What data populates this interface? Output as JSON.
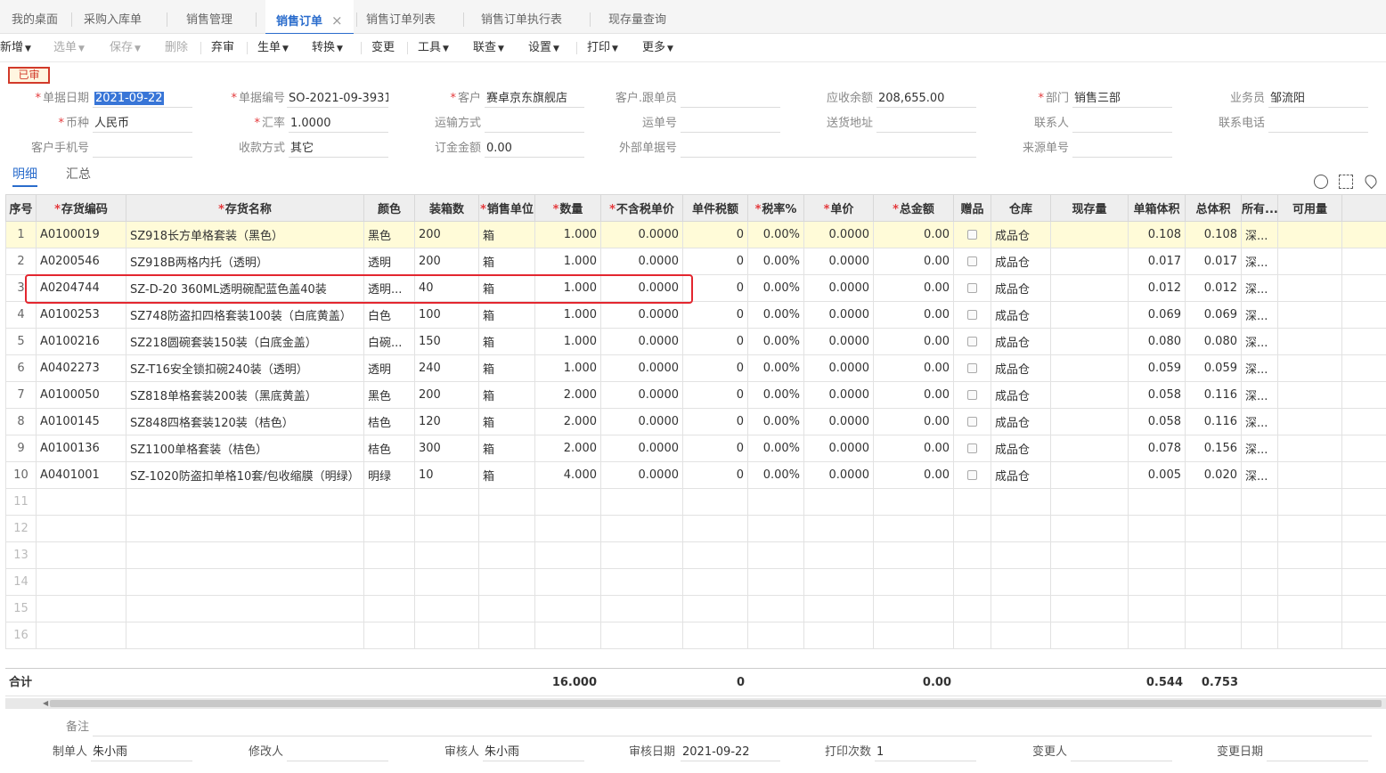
{
  "tabs": [
    {
      "label": "我的桌面"
    },
    {
      "label": "采购入库单"
    },
    {
      "label": "销售管理"
    },
    {
      "label": "销售订单",
      "close": "×"
    },
    {
      "label": "销售订单列表"
    },
    {
      "label": "销售订单执行表"
    },
    {
      "label": "现存量查询"
    }
  ],
  "toolbar": [
    {
      "label": "新增"
    },
    {
      "label": "选单"
    },
    {
      "label": "保存"
    },
    {
      "label": "删除"
    },
    {
      "label": "弃审"
    },
    {
      "label": "生单"
    },
    {
      "label": "转换"
    },
    {
      "label": "变更"
    },
    {
      "label": "工具"
    },
    {
      "label": "联查"
    },
    {
      "label": "设置"
    },
    {
      "label": "打印"
    },
    {
      "label": "更多"
    }
  ],
  "status_stamp": "已审",
  "header": {
    "date": {
      "label": "单据日期",
      "value": "2021-09-22"
    },
    "code": {
      "label": "单据编号",
      "value": "SO-2021-09-3931"
    },
    "customer": {
      "label": "客户",
      "value": "赛卓京东旗舰店"
    },
    "followup": {
      "label": "客户.跟单员",
      "value": ""
    },
    "receivable": {
      "label": "应收余额",
      "value": "208,655.00"
    },
    "dept": {
      "label": "部门",
      "value": "销售三部"
    },
    "salesman": {
      "label": "业务员",
      "value": "邹流阳"
    },
    "currency": {
      "label": "币种",
      "value": "人民币"
    },
    "rate": {
      "label": "汇率",
      "value": "1.0000"
    },
    "shipping": {
      "label": "运输方式",
      "value": ""
    },
    "waybill": {
      "label": "运单号",
      "value": ""
    },
    "address": {
      "label": "送货地址",
      "value": ""
    },
    "contact": {
      "label": "联系人",
      "value": ""
    },
    "phone": {
      "label": "联系电话",
      "value": ""
    },
    "mobile": {
      "label": "客户手机号",
      "value": ""
    },
    "payment": {
      "label": "收款方式",
      "value": "其它"
    },
    "deposit": {
      "label": "订金金额",
      "value": "0.00"
    },
    "external": {
      "label": "外部单据号",
      "value": ""
    },
    "source": {
      "label": "来源单号",
      "value": ""
    }
  },
  "subtabs": [
    {
      "label": "明细"
    },
    {
      "label": "汇总"
    }
  ],
  "columns": [
    "序号",
    "存货编码",
    "存货名称",
    "颜色",
    "装箱数",
    "销售单位",
    "数量",
    "不含税单价",
    "单件税额",
    "税率%",
    "单价",
    "总金额",
    "赠品",
    "仓库",
    "现存量",
    "单箱体积",
    "总体积",
    "所有...",
    "可用量"
  ],
  "rows": [
    [
      "1",
      "A0100019",
      "SZ918长方单格套装（黑色）",
      "黑色",
      "200",
      "箱",
      "1.000",
      "0.0000",
      "0",
      "0.00%",
      "0.0000",
      "0.00",
      "",
      "成品仓",
      "",
      "0.108",
      "0.108",
      "深...",
      ""
    ],
    [
      "2",
      "A0200546",
      "SZ918B两格内托（透明）",
      "透明",
      "200",
      "箱",
      "1.000",
      "0.0000",
      "0",
      "0.00%",
      "0.0000",
      "0.00",
      "",
      "成品仓",
      "",
      "0.017",
      "0.017",
      "深...",
      ""
    ],
    [
      "3",
      "A0204744",
      "SZ-D-20 360ML透明碗配蓝色盖40装",
      "透明...",
      "40",
      "箱",
      "1.000",
      "0.0000",
      "0",
      "0.00%",
      "0.0000",
      "0.00",
      "",
      "成品仓",
      "",
      "0.012",
      "0.012",
      "深...",
      ""
    ],
    [
      "4",
      "A0100253",
      "SZ748防盗扣四格套装100装（白底黄盖）",
      "白色",
      "100",
      "箱",
      "1.000",
      "0.0000",
      "0",
      "0.00%",
      "0.0000",
      "0.00",
      "",
      "成品仓",
      "",
      "0.069",
      "0.069",
      "深...",
      ""
    ],
    [
      "5",
      "A0100216",
      "SZ218圆碗套装150装（白底金盖）",
      "白碗...",
      "150",
      "箱",
      "1.000",
      "0.0000",
      "0",
      "0.00%",
      "0.0000",
      "0.00",
      "",
      "成品仓",
      "",
      "0.080",
      "0.080",
      "深...",
      ""
    ],
    [
      "6",
      "A0402273",
      "SZ-T16安全锁扣碗240装（透明）",
      "透明",
      "240",
      "箱",
      "1.000",
      "0.0000",
      "0",
      "0.00%",
      "0.0000",
      "0.00",
      "",
      "成品仓",
      "",
      "0.059",
      "0.059",
      "深...",
      ""
    ],
    [
      "7",
      "A0100050",
      "SZ818单格套装200装（黑底黄盖）",
      "黑色",
      "200",
      "箱",
      "2.000",
      "0.0000",
      "0",
      "0.00%",
      "0.0000",
      "0.00",
      "",
      "成品仓",
      "",
      "0.058",
      "0.116",
      "深...",
      ""
    ],
    [
      "8",
      "A0100145",
      "SZ848四格套装120装（桔色）",
      "桔色",
      "120",
      "箱",
      "2.000",
      "0.0000",
      "0",
      "0.00%",
      "0.0000",
      "0.00",
      "",
      "成品仓",
      "",
      "0.058",
      "0.116",
      "深...",
      ""
    ],
    [
      "9",
      "A0100136",
      "SZ1100单格套装（桔色）",
      "桔色",
      "300",
      "箱",
      "2.000",
      "0.0000",
      "0",
      "0.00%",
      "0.0000",
      "0.00",
      "",
      "成品仓",
      "",
      "0.078",
      "0.156",
      "深...",
      ""
    ],
    [
      "10",
      "A0401001",
      "SZ-1020防盗扣单格10套/包收缩膜（明绿）",
      "明绿",
      "10",
      "箱",
      "4.000",
      "0.0000",
      "0",
      "0.00%",
      "0.0000",
      "0.00",
      "",
      "成品仓",
      "",
      "0.005",
      "0.020",
      "深...",
      ""
    ]
  ],
  "empty_rows": [
    "11",
    "12",
    "13",
    "14",
    "15",
    "16"
  ],
  "totals": {
    "label": "合计",
    "qty": "16.000",
    "tax": "0",
    "amount": "0.00",
    "unit_vol": "0.544",
    "total_vol": "0.753"
  },
  "footer": {
    "remark": {
      "label": "备注",
      "value": ""
    },
    "maker": {
      "label": "制单人",
      "value": "朱小雨"
    },
    "modifier": {
      "label": "修改人",
      "value": ""
    },
    "auditor": {
      "label": "审核人",
      "value": "朱小雨"
    },
    "audit_date": {
      "label": "审核日期",
      "value": "2021-09-22"
    },
    "print_count": {
      "label": "打印次数",
      "value": "1"
    },
    "changer": {
      "label": "变更人",
      "value": ""
    },
    "change_date": {
      "label": "变更日期",
      "value": ""
    }
  },
  "colors": {
    "accent": "#2a6ccc",
    "highlight_box": "#e3262f",
    "selected_row": "#fffbd8"
  }
}
